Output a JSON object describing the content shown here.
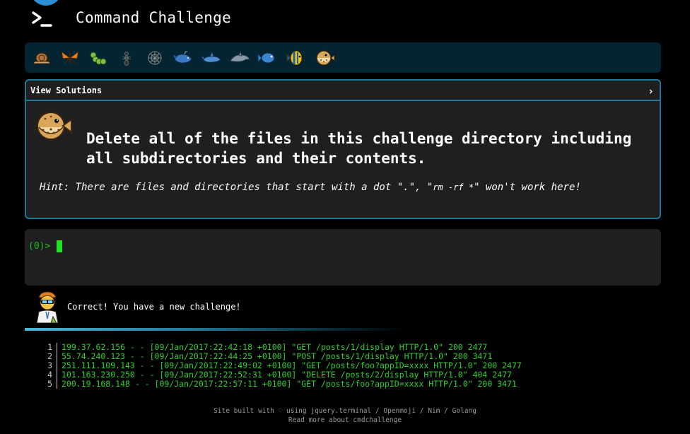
{
  "header": {
    "title": "Command Challenge"
  },
  "progress": {
    "critters": [
      "snail",
      "butterfly",
      "caterpillar",
      "ant",
      "spider-web",
      "whale",
      "shark",
      "dolphin",
      "fish",
      "tropical-fish",
      "blowfish"
    ]
  },
  "challenge": {
    "solutions_label": "View Solutions",
    "chevron": "›",
    "text": "Delete all of the files in this challenge directory including all subdirectories and their contents.",
    "hint_prefix": "Hint: There are files and directories that start with a dot \".\", \"",
    "hint_code": "rm -rf *",
    "hint_suffix": "\" won't work here!"
  },
  "terminal": {
    "prompt": "(0)>"
  },
  "result": {
    "message": "Correct! You have a new challenge!"
  },
  "log": [
    {
      "num": "1",
      "line": "199.37.62.156 - - [09/Jan/2017:22:42:18 +0100] \"GET /posts/1/display HTTP/1.0\" 200 2477"
    },
    {
      "num": "2",
      "line": "55.74.240.123 - - [09/Jan/2017:22:44:25 +0100] \"POST /posts/1/display HTTP/1.0\" 200 3471"
    },
    {
      "num": "3",
      "line": "251.111.109.143 - - [09/Jan/2017:22:49:02 +0100] \"GET /posts/foo?appID=xxxx HTTP/1.0\" 200 2477"
    },
    {
      "num": "4",
      "line": "101.163.230.250 - - [09/Jan/2017:22:52:31 +0100] \"DELETE /posts/2/display HTTP/1.0\" 404 2477"
    },
    {
      "num": "5",
      "line": "200.19.168.148 - - [09/Jan/2017:22:57:11 +0100] \"GET /posts/foo?appID=xxxx HTTP/1.0\" 200 3471"
    }
  ],
  "footer": {
    "prefix": "Site built with ♡ using ",
    "jquery": "jquery.terminal",
    "sep1": " / ",
    "openmoji": "Openmoji",
    "sep2": " / ",
    "nim": "Nim",
    "sep3": " / ",
    "golang": "Golang",
    "read_more": "Read more about cmdchallenge"
  }
}
